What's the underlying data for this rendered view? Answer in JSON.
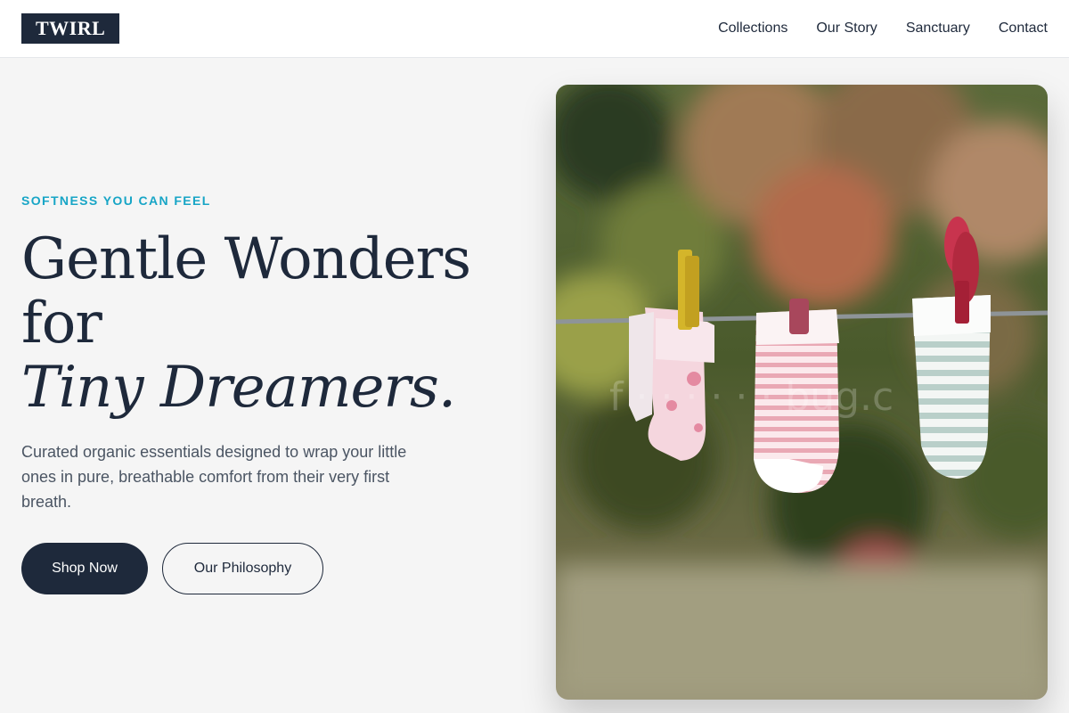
{
  "header": {
    "logo": "TWIRL",
    "nav": [
      "Collections",
      "Our Story",
      "Sanctuary",
      "Contact"
    ]
  },
  "hero": {
    "eyebrow": "SOFTNESS YOU CAN FEEL",
    "headline": {
      "line1": "Gentle Wonders",
      "line2": "for",
      "line3": "Tiny Dreamers."
    },
    "subtext": "Curated organic essentials designed to wrap your little ones in pure, breathable comfort from their very first breath.",
    "primary_button": "Shop Now",
    "secondary_button": "Our Philosophy"
  },
  "colors": {
    "brand_dark": "#1e293b",
    "accent": "#17a5c6",
    "background": "#f5f5f5"
  }
}
